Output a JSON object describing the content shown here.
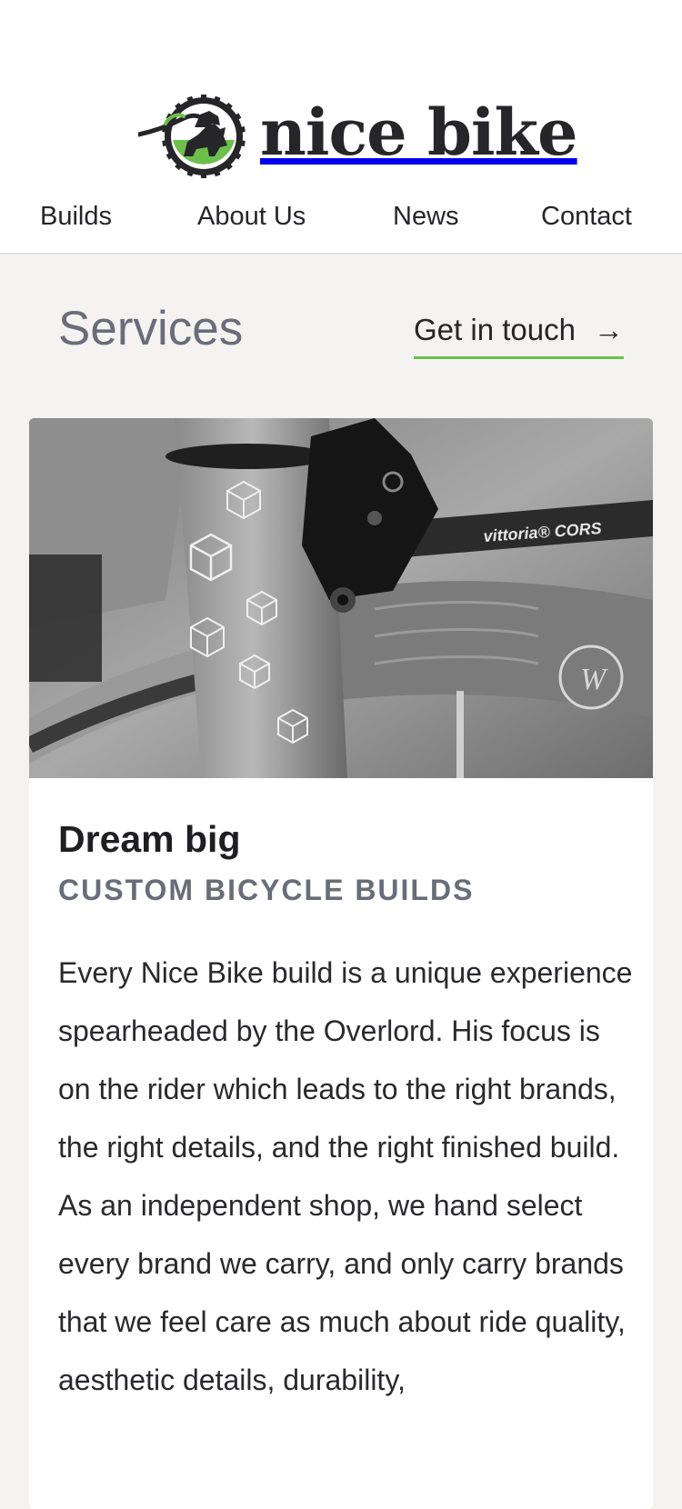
{
  "brand": {
    "name": "nice bike",
    "accent": "#6cc04a"
  },
  "nav": {
    "items": [
      "Builds",
      "About Us",
      "News",
      "Contact"
    ]
  },
  "services": {
    "title": "Services",
    "cta_label": "Get in touch",
    "cta_arrow": "→"
  },
  "card": {
    "title": "Dream big",
    "subtitle": "CUSTOM BICYCLE BUILDS",
    "paragraphs": [
      "Every Nice Bike build is a unique experience spearheaded by the Overlord. His focus is on the rider which leads to the right brands, the right details, and the right finished build.",
      "As an independent shop, we hand select every brand we carry, and only carry brands that we feel care as much about ride quality, aesthetic details, durability,"
    ],
    "image_text": {
      "tire": "vittoria® CORS",
      "rim_logo": "W"
    }
  }
}
